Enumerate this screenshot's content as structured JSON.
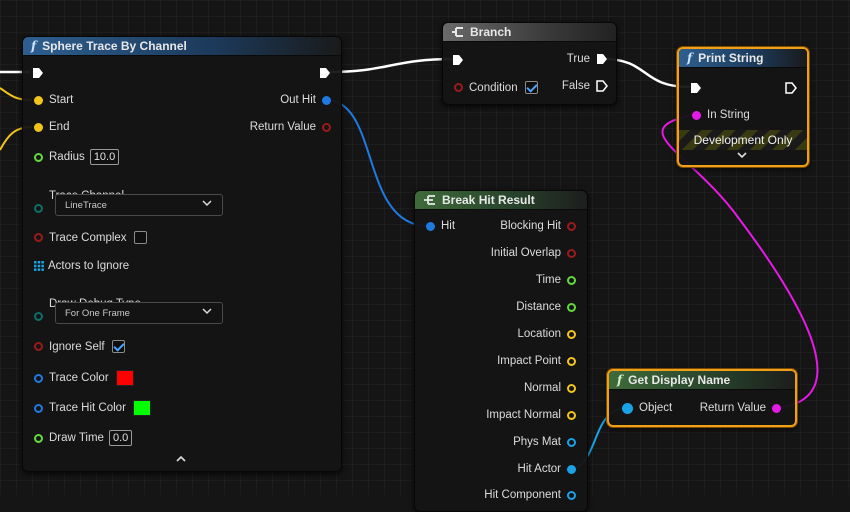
{
  "colors": {
    "exec": "#ffffff",
    "vector": "#f3c41a",
    "float": "#62d93d",
    "struct": "#1f7ae0",
    "bool": "#9b1b1b",
    "enum": "#0c6f6a",
    "object": "#1aa2e6",
    "string": "#e61ae6",
    "selected": "#f0a018"
  },
  "sphere_trace": {
    "title": "Sphere Trace By Channel",
    "icon": "f",
    "out_hit": "Out Hit",
    "return_value": "Return Value",
    "start": "Start",
    "end": "End",
    "radius_label": "Radius",
    "radius_value": "10.0",
    "trace_channel_label": "Trace Channel",
    "trace_channel_value": "LineTrace",
    "trace_complex_label": "Trace Complex",
    "actors_to_ignore": "Actors to Ignore",
    "draw_debug_type_label": "Draw Debug Type",
    "draw_debug_type_value": "For One Frame",
    "ignore_self_label": "Ignore Self",
    "trace_color_label": "Trace Color",
    "trace_color": "#ff0000",
    "trace_hit_color_label": "Trace Hit Color",
    "trace_hit_color": "#00ff00",
    "draw_time_label": "Draw Time",
    "draw_time_value": "0.0",
    "collapse_glyph": "⌃"
  },
  "branch": {
    "title": "Branch",
    "condition": "Condition",
    "true_label": "True",
    "false_label": "False"
  },
  "print_string": {
    "title": "Print String",
    "icon": "f",
    "in_string": "In String",
    "dev_only": "Development Only",
    "expand_glyph": "⌄"
  },
  "break_hit": {
    "title": "Break Hit Result",
    "hit": "Hit",
    "outputs": [
      "Blocking Hit",
      "Initial Overlap",
      "Time",
      "Distance",
      "Location",
      "Impact Point",
      "Normal",
      "Impact Normal",
      "Phys Mat",
      "Hit Actor",
      "Hit Component"
    ]
  },
  "get_display_name": {
    "title": "Get Display Name",
    "icon": "f",
    "object": "Object",
    "return_value": "Return Value"
  }
}
